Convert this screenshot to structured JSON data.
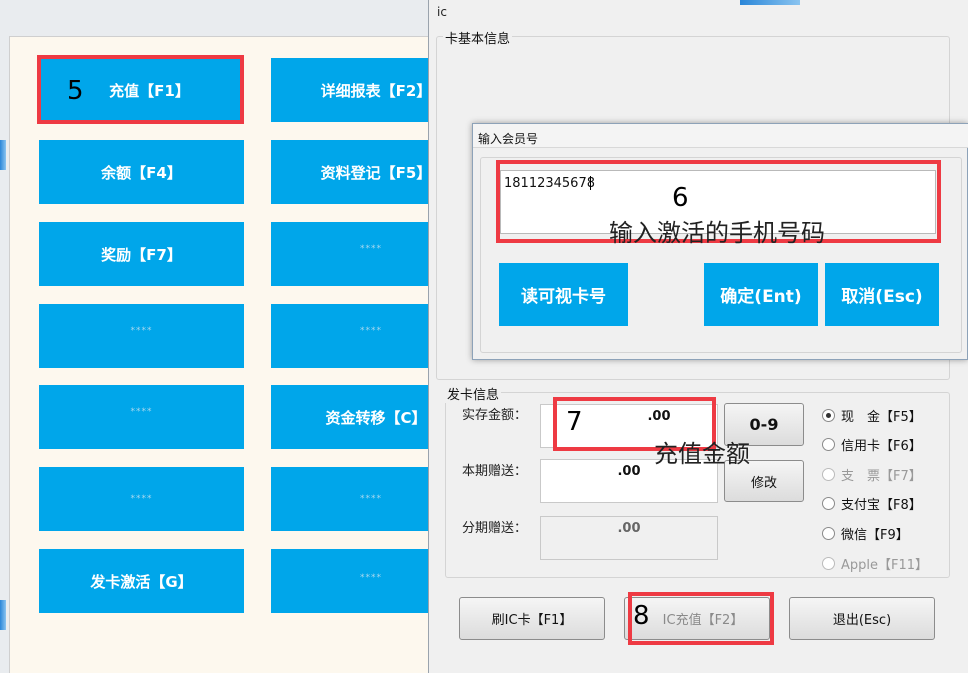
{
  "left_panel": {
    "tiles": [
      {
        "label": "充值【F1】"
      },
      {
        "label": "详细报表【F2】"
      },
      {
        "label": "余额【F4】"
      },
      {
        "label": "资料登记【F5】"
      },
      {
        "label": "奖励【F7】"
      },
      {
        "label": "****"
      },
      {
        "label": "****"
      },
      {
        "label": "****"
      },
      {
        "label": "****"
      },
      {
        "label": "资金转移【C】"
      },
      {
        "label": "****"
      },
      {
        "label": "****"
      },
      {
        "label": "发卡激活【G】"
      },
      {
        "label": "****"
      }
    ]
  },
  "annotations": {
    "n5": "5",
    "n6": "6",
    "n7": "7",
    "n8": "8",
    "hint_phone": "输入激活的手机号码",
    "hint_amount": "充值金额"
  },
  "ic_dialog": {
    "title": "ic",
    "card_info_group": "卡基本信息",
    "issue_group": "发卡信息",
    "deposit_label": "实存金额：",
    "deposit_value": ".00",
    "keypad_button": "0-9",
    "bonus_label": "本期赠送：",
    "bonus_value": ".00",
    "modify_button": "修改",
    "installment_label": "分期赠送：",
    "installment_value": ".00",
    "payment_methods": [
      {
        "label": "现　金【F5】",
        "selected": true,
        "enabled": true
      },
      {
        "label": "信用卡【F6】",
        "selected": false,
        "enabled": true
      },
      {
        "label": "支　票【F7】",
        "selected": false,
        "enabled": false
      },
      {
        "label": "支付宝【F8】",
        "selected": false,
        "enabled": true
      },
      {
        "label": "微信【F9】",
        "selected": false,
        "enabled": true
      },
      {
        "label": "Apple【F11】",
        "selected": false,
        "enabled": false
      }
    ],
    "swipe_button": "刷IC卡【F1】",
    "recharge_button": "IC充值【F2】",
    "exit_button": "退出(Esc)"
  },
  "member_dialog": {
    "title": "输入会员号",
    "input_value": "18112345678",
    "read_card_button": "读可视卡号",
    "confirm_button": "确定(Ent)",
    "cancel_button": "取消(Esc)"
  }
}
